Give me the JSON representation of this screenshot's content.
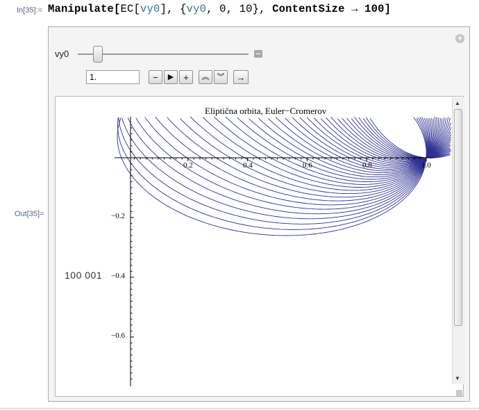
{
  "notebook": {
    "in_label": "In[35]:=",
    "out_label": "Out[35]=",
    "input": {
      "head": "Manipulate[",
      "fn": "EC[",
      "arg": "vy0",
      "close1": "], {",
      "var": "vy0",
      "range": ", 0, 10}, ",
      "opt": "ContentSize",
      "arrow": " → ",
      "val": "100]"
    }
  },
  "manipulate": {
    "control_label": "vy0",
    "slider_value": 0.1,
    "field_value": "1.",
    "buttons": [
      {
        "icon": "minus-icon",
        "glyph": "−"
      },
      {
        "icon": "play-icon",
        "glyph": "▶"
      },
      {
        "icon": "plus-icon",
        "glyph": "+"
      },
      {
        "icon": "faster-icon",
        "glyph": "︽"
      },
      {
        "icon": "slower-icon",
        "glyph": "︾"
      },
      {
        "icon": "direction-arrow-icon",
        "glyph": "→"
      }
    ],
    "corner_button": "+"
  },
  "output": {
    "count_label": "100 001"
  },
  "chart_data": {
    "type": "line",
    "title": "Eliptična orbita, Euler−Cromerov",
    "xlabel": "",
    "ylabel": "",
    "xlim": [
      0,
      1.0
    ],
    "ylim": [
      -0.78,
      0.13
    ],
    "x_ticks": [
      "0.2",
      "0.4",
      "0.6",
      "0.8",
      "1.0"
    ],
    "y_ticks": [
      "−0.2",
      "−0.4",
      "−0.6"
    ],
    "series_color": "#2e3192",
    "series_description": "family of precessing ellipses starting at (1,0), one per Euler-Cromer orbit",
    "orbit_count": 36
  }
}
